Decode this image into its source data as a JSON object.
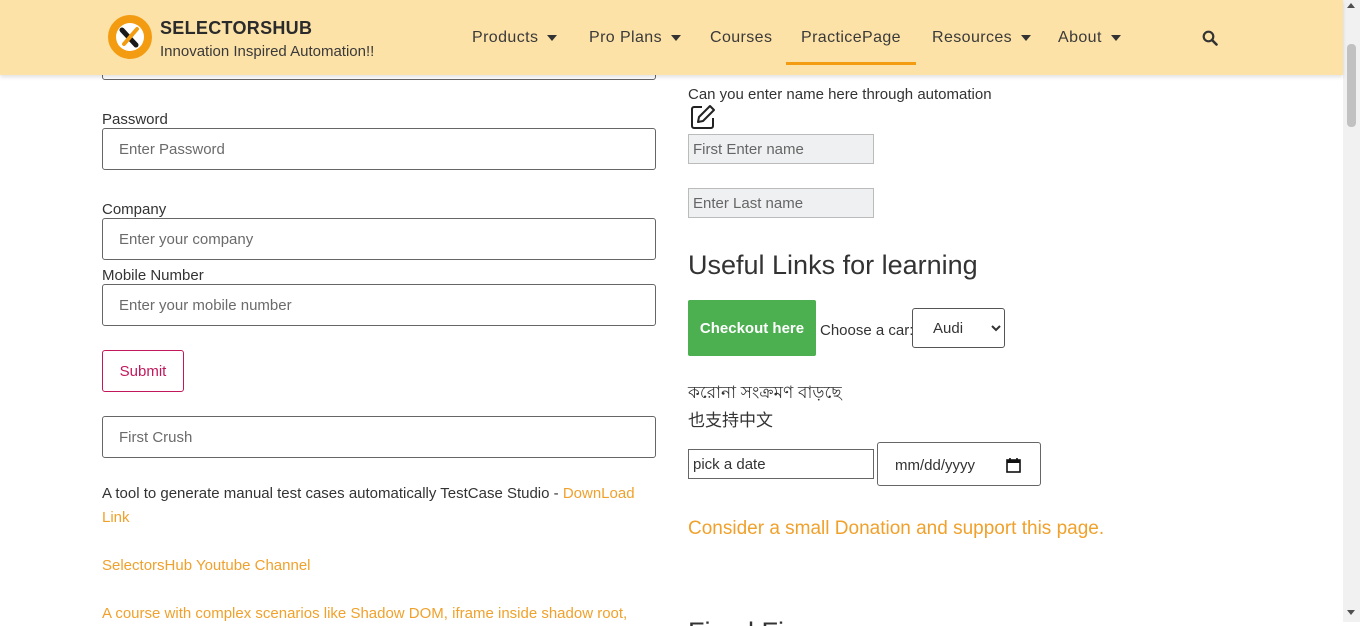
{
  "header": {
    "brand_name": "SELECTORSHUB",
    "tagline": "Innovation Inspired Automation!!",
    "nav": [
      {
        "label": "Products",
        "dropdown": true
      },
      {
        "label": "Pro Plans",
        "dropdown": true
      },
      {
        "label": "Courses",
        "dropdown": false
      },
      {
        "label": "PracticePage",
        "dropdown": false,
        "active": true
      },
      {
        "label": "Resources",
        "dropdown": true
      },
      {
        "label": "About",
        "dropdown": true
      }
    ],
    "search_icon": "search-icon",
    "bg_color": "#fde2a7",
    "accent": "#f39c12"
  },
  "form": {
    "password_label": "Password",
    "password_placeholder": "Enter Password",
    "company_label": "Company",
    "company_placeholder": "Enter your company",
    "mobile_label": "Mobile Number",
    "mobile_placeholder": "Enter your mobile number",
    "submit_label": "Submit",
    "first_crush_placeholder": "First Crush"
  },
  "left_content": {
    "testcase_text": "A tool to generate manual test cases automatically TestCase Studio - ",
    "download_link": "DownLoad Link",
    "youtube_link": "SelectorsHub Youtube Channel",
    "course_link": "A course with complex scenarios like Shadow DOM, iframe inside shadow root,"
  },
  "right_content": {
    "automation_prompt": "Can you enter name here through automation",
    "first_name_placeholder": "First Enter name",
    "last_name_placeholder": "Enter Last name",
    "useful_links_heading": "Useful Links for learning",
    "checkout_label": "Checkout here",
    "choose_car_label": "Choose a car:",
    "car_selected": "Audi",
    "bengali_text": "করোনা সংক্রমণ বাড়ছে",
    "chinese_text": "也支持中文",
    "pick_date_value": "pick a date",
    "date_placeholder": "mm/dd/yyyy",
    "donation_link": "Consider a small Donation and support this page.",
    "partial_heading": "Fixed Fi"
  },
  "colors": {
    "link": "#f0a12c",
    "submit": "#c2185b",
    "checkout": "#4caf50"
  }
}
